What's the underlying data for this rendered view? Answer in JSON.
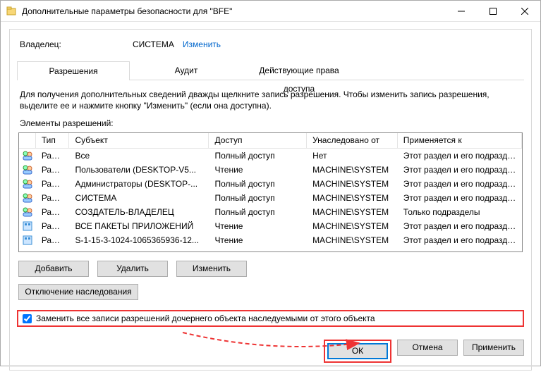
{
  "titlebar": {
    "title": "Дополнительные параметры безопасности  для \"BFE\""
  },
  "owner": {
    "label": "Владелец:",
    "value": "СИСТЕМА",
    "change": "Изменить"
  },
  "tabs": {
    "t0": "Разрешения",
    "t1": "Аудит",
    "t2": "Действующие права доступа"
  },
  "hint": "Для получения дополнительных сведений дважды щелкните запись разрешения. Чтобы изменить запись разрешения, выделите ее и нажмите кнопку \"Изменить\" (если она доступна).",
  "sectionLabel": "Элементы разрешений:",
  "columns": {
    "type": "Тип",
    "subject": "Субъект",
    "access": "Доступ",
    "inherited": "Унаследовано от",
    "applies": "Применяется к"
  },
  "rows": [
    {
      "icon": "people",
      "type": "Разр...",
      "subject": "Все",
      "access": "Полный доступ",
      "inherited": "Нет",
      "applies": "Этот раздел и его подразделы"
    },
    {
      "icon": "people",
      "type": "Разр...",
      "subject": "Пользователи (DESKTOP-V5...",
      "access": "Чтение",
      "inherited": "MACHINE\\SYSTEM",
      "applies": "Этот раздел и его подразделы"
    },
    {
      "icon": "people",
      "type": "Разр...",
      "subject": "Администраторы (DESKTOP-...",
      "access": "Полный доступ",
      "inherited": "MACHINE\\SYSTEM",
      "applies": "Этот раздел и его подразделы"
    },
    {
      "icon": "people",
      "type": "Разр...",
      "subject": "СИСТЕМА",
      "access": "Полный доступ",
      "inherited": "MACHINE\\SYSTEM",
      "applies": "Этот раздел и его подразделы"
    },
    {
      "icon": "people",
      "type": "Разр...",
      "subject": "СОЗДАТЕЛЬ-ВЛАДЕЛЕЦ",
      "access": "Полный доступ",
      "inherited": "MACHINE\\SYSTEM",
      "applies": "Только подразделы"
    },
    {
      "icon": "pkg",
      "type": "Разр...",
      "subject": "ВСЕ ПАКЕТЫ ПРИЛОЖЕНИЙ",
      "access": "Чтение",
      "inherited": "MACHINE\\SYSTEM",
      "applies": "Этот раздел и его подразделы"
    },
    {
      "icon": "pkg",
      "type": "Разр...",
      "subject": "S-1-15-3-1024-1065365936-12...",
      "access": "Чтение",
      "inherited": "MACHINE\\SYSTEM",
      "applies": "Этот раздел и его подразделы"
    }
  ],
  "buttons": {
    "add": "Добавить",
    "remove": "Удалить",
    "edit": "Изменить",
    "disableInh": "Отключение наследования",
    "ok": "ОК",
    "cancel": "Отмена",
    "apply": "Применить"
  },
  "checkbox": {
    "label": "Заменить все записи разрешений дочернего объекта наследуемыми от этого объекта",
    "checked": true
  },
  "colors": {
    "highlight": "#e33",
    "accent": "#0078d7"
  }
}
